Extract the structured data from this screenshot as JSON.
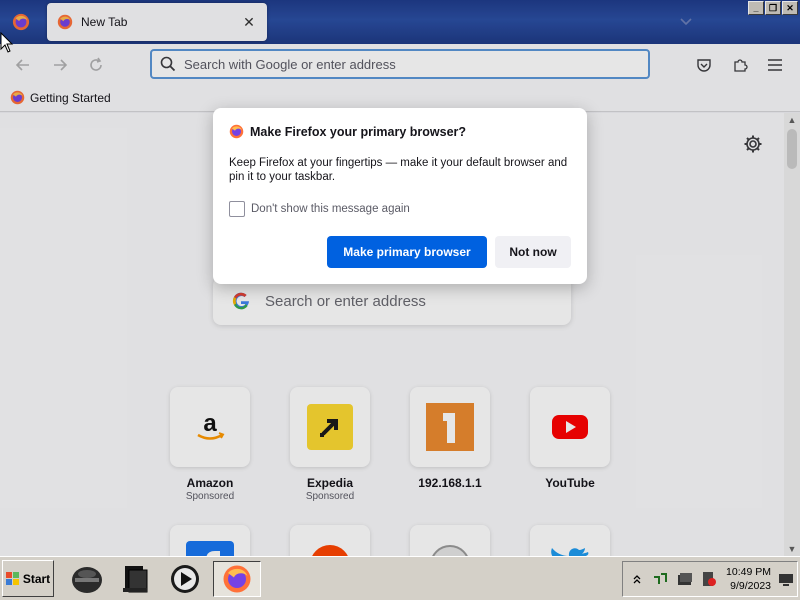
{
  "browser": {
    "tab": {
      "title": "New Tab",
      "close_glyph": "✕"
    },
    "window_buttons": [
      "_",
      "❐",
      "✕"
    ],
    "url_placeholder": "Search with Google or enter address",
    "bookmarks": [
      {
        "label": "Getting Started"
      }
    ]
  },
  "newtab": {
    "search_placeholder": "Search or enter address",
    "tiles": [
      {
        "title": "Amazon",
        "sub": "Sponsored",
        "icon": "amazon-icon"
      },
      {
        "title": "Expedia",
        "sub": "Sponsored",
        "icon": "expedia-icon"
      },
      {
        "title": "192.168.1.1",
        "sub": "",
        "icon": "site-1-icon"
      },
      {
        "title": "YouTube",
        "sub": "",
        "icon": "youtube-icon"
      }
    ]
  },
  "modal": {
    "title": "Make Firefox your primary browser?",
    "body": "Keep Firefox at your fingertips — make it your default browser and pin it to your taskbar.",
    "checkbox_label": "Don't show this message again",
    "checkbox_checked": false,
    "primary_button": "Make primary browser",
    "secondary_button": "Not now"
  },
  "taskbar": {
    "start_label": "Start",
    "apps": [
      "vpn-helmet-icon",
      "media-app-icon",
      "media-player-icon",
      "firefox-icon"
    ],
    "clock_time": "10:49 PM",
    "clock_date": "9/9/2023"
  },
  "colors": {
    "accent": "#0061e0",
    "titlebar": "#2a4ea3",
    "urlbar_focus": "#5b97d8",
    "youtube_red": "#ff0000",
    "expedia_yellow": "#fddb32"
  }
}
